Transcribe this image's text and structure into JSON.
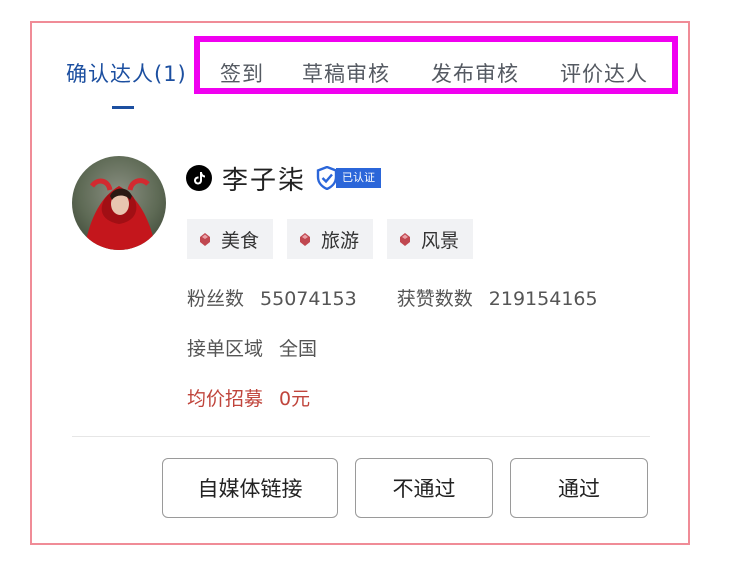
{
  "tabs": {
    "confirm": "确认达人(1)",
    "checkin": "签到",
    "draft_review": "草稿审核",
    "publish_review": "发布审核",
    "rate": "评价达人"
  },
  "creator": {
    "platform_icon": "tiktok-icon",
    "name": "李子柒",
    "verified_label": "已认证",
    "tags": [
      "美食",
      "旅游",
      "风景"
    ],
    "followers_label": "粉丝数",
    "followers_value": "55074153",
    "likes_label": "获赞数数",
    "likes_value": "219154165",
    "region_label": "接单区域",
    "region_value": "全国",
    "price_label": "均价招募",
    "price_value": "0元"
  },
  "actions": {
    "media_link": "自媒体链接",
    "reject": "不通过",
    "approve": "通过"
  },
  "colors": {
    "active_tab": "#1c4fa0",
    "highlight": "#f000f0",
    "frame": "#f08c97",
    "verified": "#2b66d9",
    "price": "#c0453c"
  }
}
